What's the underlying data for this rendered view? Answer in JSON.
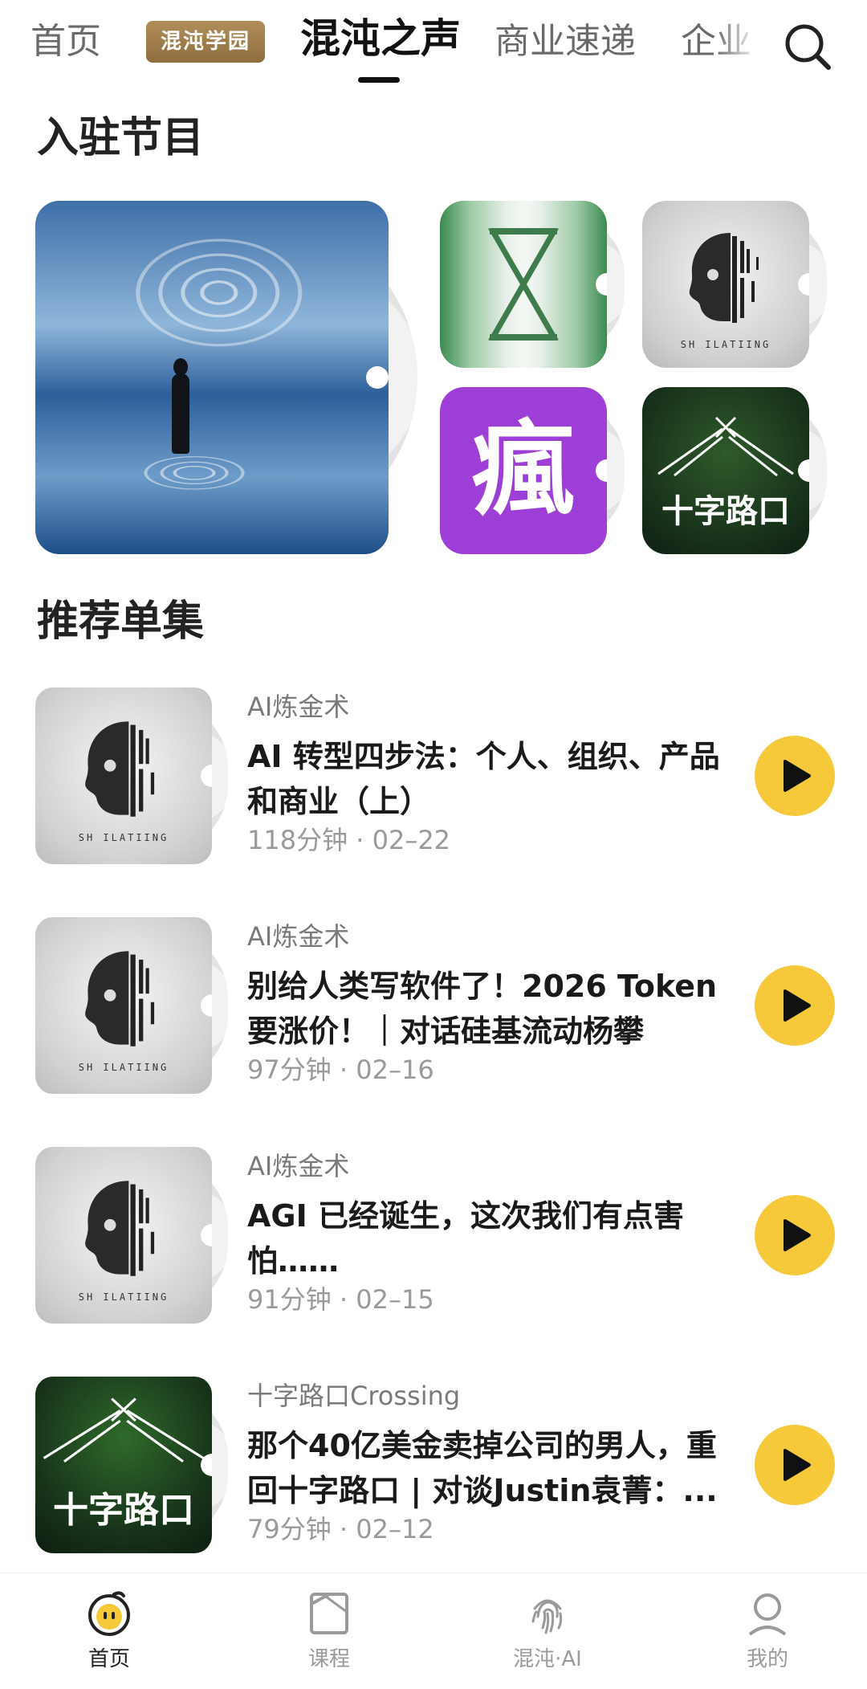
{
  "top_nav": {
    "home": "首页",
    "academy_badge": "混沌学园",
    "active_tab": "混沌之声",
    "business": "商业速递",
    "enterprise": "企业"
  },
  "sections": {
    "programs_title": "入驻节目",
    "episodes_title": "推荐单集"
  },
  "program_covers": {
    "crazy_glyph": "瘋",
    "crossing_cover_text": "十字路口",
    "skull_caption": "SH ILATIING"
  },
  "episodes": [
    {
      "show": "AI炼金术",
      "title": "AI 转型四步法：个人、组织、产品和商业（上）",
      "meta": "118分钟 · 02–22"
    },
    {
      "show": "AI炼金术",
      "title": "别给人类写软件了！2026 Token 要涨价！｜对话硅基流动杨攀",
      "meta": "97分钟 · 02–16"
    },
    {
      "show": "AI炼金术",
      "title": "AGI 已经诞生，这次我们有点害怕……",
      "meta": "91分钟 · 02–15"
    },
    {
      "show": "十字路口Crossing",
      "title": "那个40亿美金卖掉公司的男人，重回十字路口 | 对谈Justin袁菁：...",
      "meta": "79分钟 · 02–12"
    }
  ],
  "tabbar": [
    {
      "label": "首页",
      "icon": "home-smiley-icon"
    },
    {
      "label": "课程",
      "icon": "book-icon"
    },
    {
      "label": "混沌·AI",
      "icon": "fingerprint-icon"
    },
    {
      "label": "我的",
      "icon": "person-icon"
    }
  ],
  "colors": {
    "accent_yellow": "#f6c93a",
    "badge_gold": "#a2804d",
    "purple_cover": "#9d3fd6"
  }
}
